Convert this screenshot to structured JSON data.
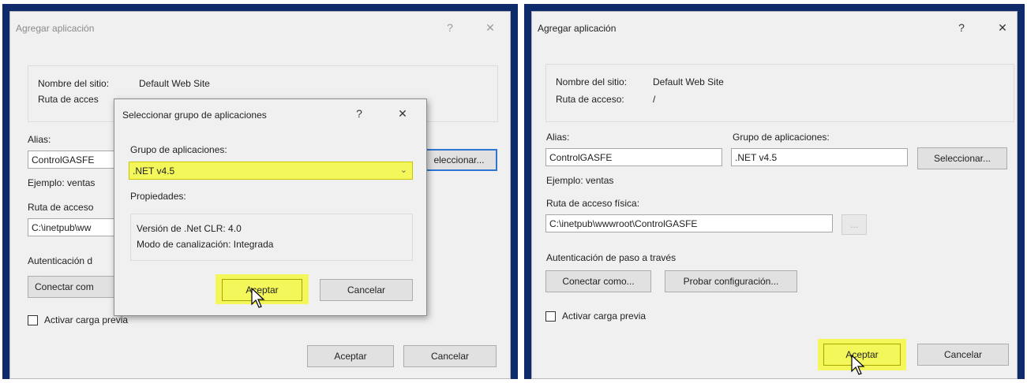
{
  "left": {
    "window_title": "Agregar aplicación",
    "help_icon": "?",
    "close_icon": "✕",
    "site_name_label": "Nombre del sitio:",
    "site_name_value": "Default Web Site",
    "path_label": "Ruta de acces",
    "alias_label": "Alias:",
    "alias_value": "ControlGASFE",
    "example": "Ejemplo: ventas",
    "physical_path_label": "Ruta de acceso",
    "physical_path_value": "C:\\inetpub\\ww",
    "auth_label": "Autenticación d",
    "connect_label": "Conectar com",
    "select_label": "eleccionar...",
    "preload_label": "Activar carga previa",
    "ok_label": "Aceptar",
    "cancel_label": "Cancelar"
  },
  "popup": {
    "title": "Seleccionar grupo de aplicaciones",
    "help_icon": "?",
    "close_icon": "✕",
    "pool_label": "Grupo de aplicaciones:",
    "pool_value": ".NET v4.5",
    "properties_label": "Propiedades:",
    "clr_version": "Versión de .Net CLR: 4.0",
    "pipeline_mode": "Modo de canalización: Integrada",
    "ok_label": "Aceptar",
    "cancel_label": "Cancelar"
  },
  "right": {
    "window_title": "Agregar aplicación",
    "help_icon": "?",
    "close_icon": "✕",
    "site_name_label": "Nombre del sitio:",
    "site_name_value": "Default Web Site",
    "path_label": "Ruta de acceso:",
    "path_value": "/",
    "alias_label": "Alias:",
    "alias_value": "ControlGASFE",
    "pool_label": "Grupo de aplicaciones:",
    "pool_value": ".NET v4.5",
    "select_label": "Seleccionar...",
    "example": "Ejemplo: ventas",
    "physical_path_label": "Ruta de acceso física:",
    "physical_path_value": "C:\\inetpub\\wwwroot\\ControlGASFE",
    "browse_label": "...",
    "auth_label": "Autenticación de paso a través",
    "connect_label": "Conectar como...",
    "test_label": "Probar configuración...",
    "preload_label": "Activar carga previa",
    "ok_label": "Aceptar",
    "cancel_label": "Cancelar"
  },
  "colors": {
    "highlight": "#f3f75a",
    "frame": "#0f2a6b",
    "focus": "#2f76d2"
  }
}
